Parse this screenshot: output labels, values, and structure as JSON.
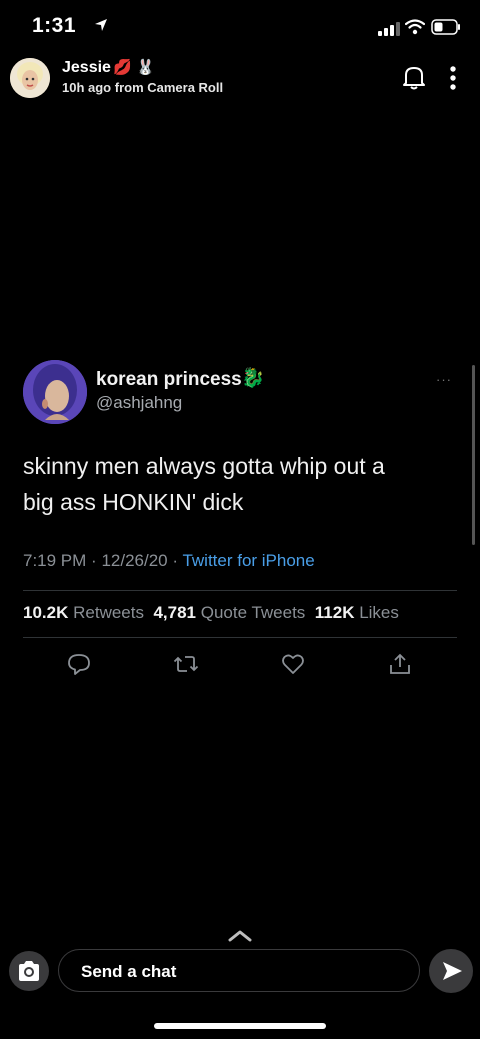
{
  "status_bar": {
    "time": "1:31"
  },
  "header": {
    "sender_name": "Jessie",
    "sender_emojis": [
      "💋",
      "🐰"
    ],
    "subtitle": "10h ago from Camera Roll"
  },
  "tweet": {
    "display_name": "korean princess",
    "name_emoji": "🐉",
    "handle": "@ashjahng",
    "text_line1": "skinny men always gotta whip out a",
    "text_line2": "big ass HONKIN' dick",
    "time": "7:19 PM",
    "date": "12/26/20",
    "source": "Twitter for iPhone",
    "retweets_count": "10.2K",
    "retweets_label": "Retweets",
    "quotes_count": "4,781",
    "quotes_label": "Quote Tweets",
    "likes_count": "112K",
    "likes_label": "Likes",
    "more_dots": "···"
  },
  "chat": {
    "placeholder": "Send a chat"
  },
  "icons": {
    "status": [
      "location-arrow-icon",
      "signal-icon",
      "wifi-icon",
      "battery-icon"
    ],
    "header": [
      "bell-icon",
      "more-vertical-icon"
    ],
    "tweet_actions": [
      "reply-icon",
      "retweet-icon",
      "like-icon",
      "share-icon"
    ],
    "bottom": [
      "chevron-up-icon",
      "camera-icon",
      "send-icon"
    ]
  },
  "colors": {
    "background": "#000000",
    "link": "#4a9fe8",
    "muted": "#8b9096",
    "avatar_bg": "#5a46b8"
  }
}
